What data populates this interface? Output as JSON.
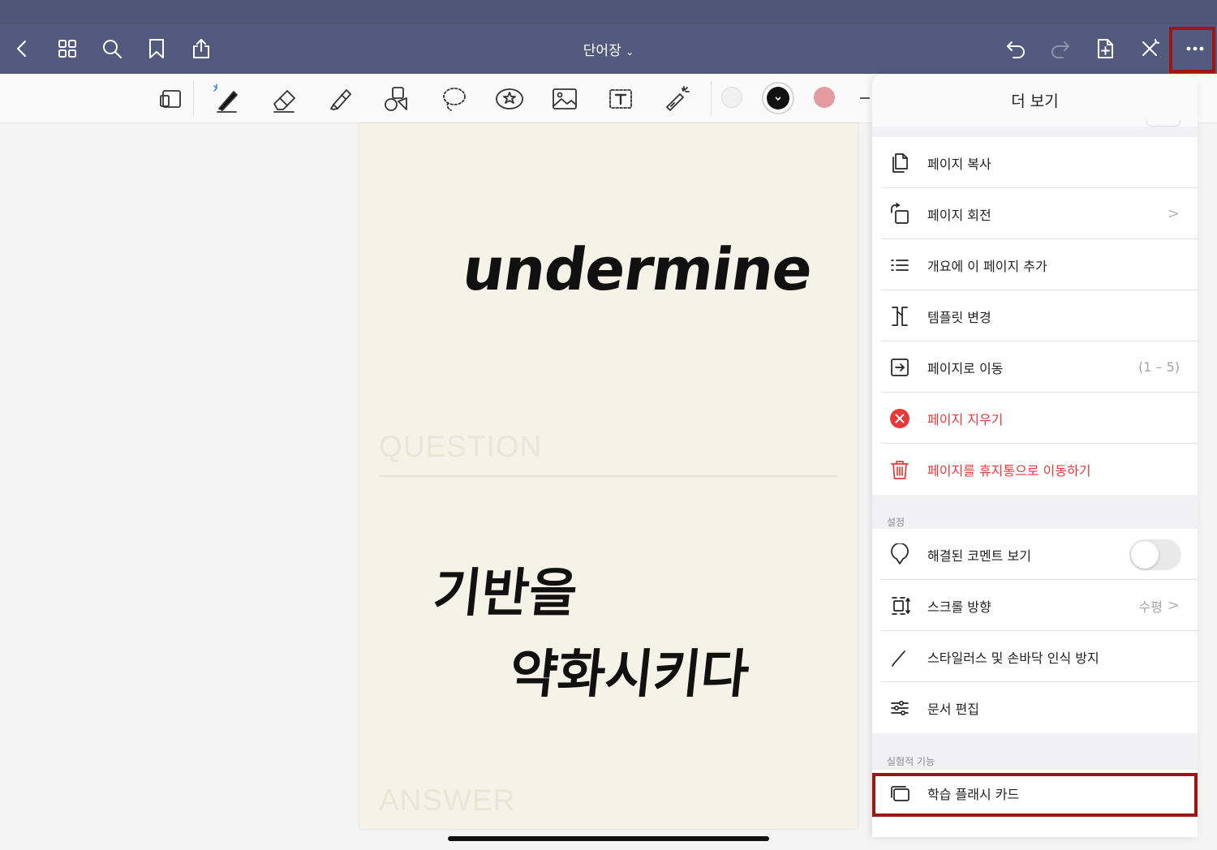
{
  "header": {
    "title": "단어장",
    "left_icons": [
      "back-chevron-icon",
      "grid-icon",
      "search-icon",
      "bookmark-icon",
      "share-icon"
    ],
    "right_icons": [
      "undo-icon",
      "redo-icon",
      "add-page-icon",
      "close-x-icon",
      "more-icon"
    ]
  },
  "toolbar": {
    "tools": [
      "page-layout-icon",
      "pen-icon",
      "eraser-icon",
      "highlighter-icon",
      "shapes-icon",
      "lasso-icon",
      "sticker-icon",
      "image-icon",
      "text-box-icon",
      "laser-pointer-icon"
    ],
    "colors": [
      "#f0f0f0",
      "#111111",
      "#e39aa0"
    ],
    "accent": "#3478f6"
  },
  "page": {
    "question_label": "QUESTION",
    "answer_label": "ANSWER",
    "word": "undermine",
    "meaning_line1": "기반을",
    "meaning_line2": "약화시키다"
  },
  "more_panel": {
    "title": "더 보기",
    "page_items": [
      {
        "label": "페이지 복사",
        "icon": "copy-page-icon"
      },
      {
        "label": "페이지 회전",
        "icon": "rotate-page-icon",
        "chevron": ">"
      },
      {
        "label": "개요에 이 페이지 추가",
        "icon": "outline-list-icon"
      },
      {
        "label": "템플릿 변경",
        "icon": "template-icon"
      },
      {
        "label": "페이지로 이동",
        "icon": "go-to-page-icon",
        "value": "(1 – 5)"
      },
      {
        "label": "페이지 지우기",
        "icon": "clear-page-icon",
        "destructive": true
      },
      {
        "label": "페이지를 휴지통으로 이동하기",
        "icon": "trash-icon",
        "destructive": true
      }
    ],
    "settings_header": "설정",
    "settings_items": [
      {
        "label": "해결된 코멘트 보기",
        "icon": "comment-icon",
        "toggle": false
      },
      {
        "label": "스크롤 방향",
        "icon": "scroll-direction-icon",
        "value": "수평",
        "chevron": ">"
      },
      {
        "label": "스타일러스 및 손바닥 인식 방지",
        "icon": "stylus-icon"
      },
      {
        "label": "문서 편집",
        "icon": "sliders-icon"
      }
    ],
    "experimental_header": "실험적 기능",
    "experimental_items": [
      {
        "label": "학습 플래시 카드",
        "icon": "flashcards-icon"
      }
    ],
    "highlight_color": "#a0150f",
    "destructive_color": "#e8393a"
  }
}
